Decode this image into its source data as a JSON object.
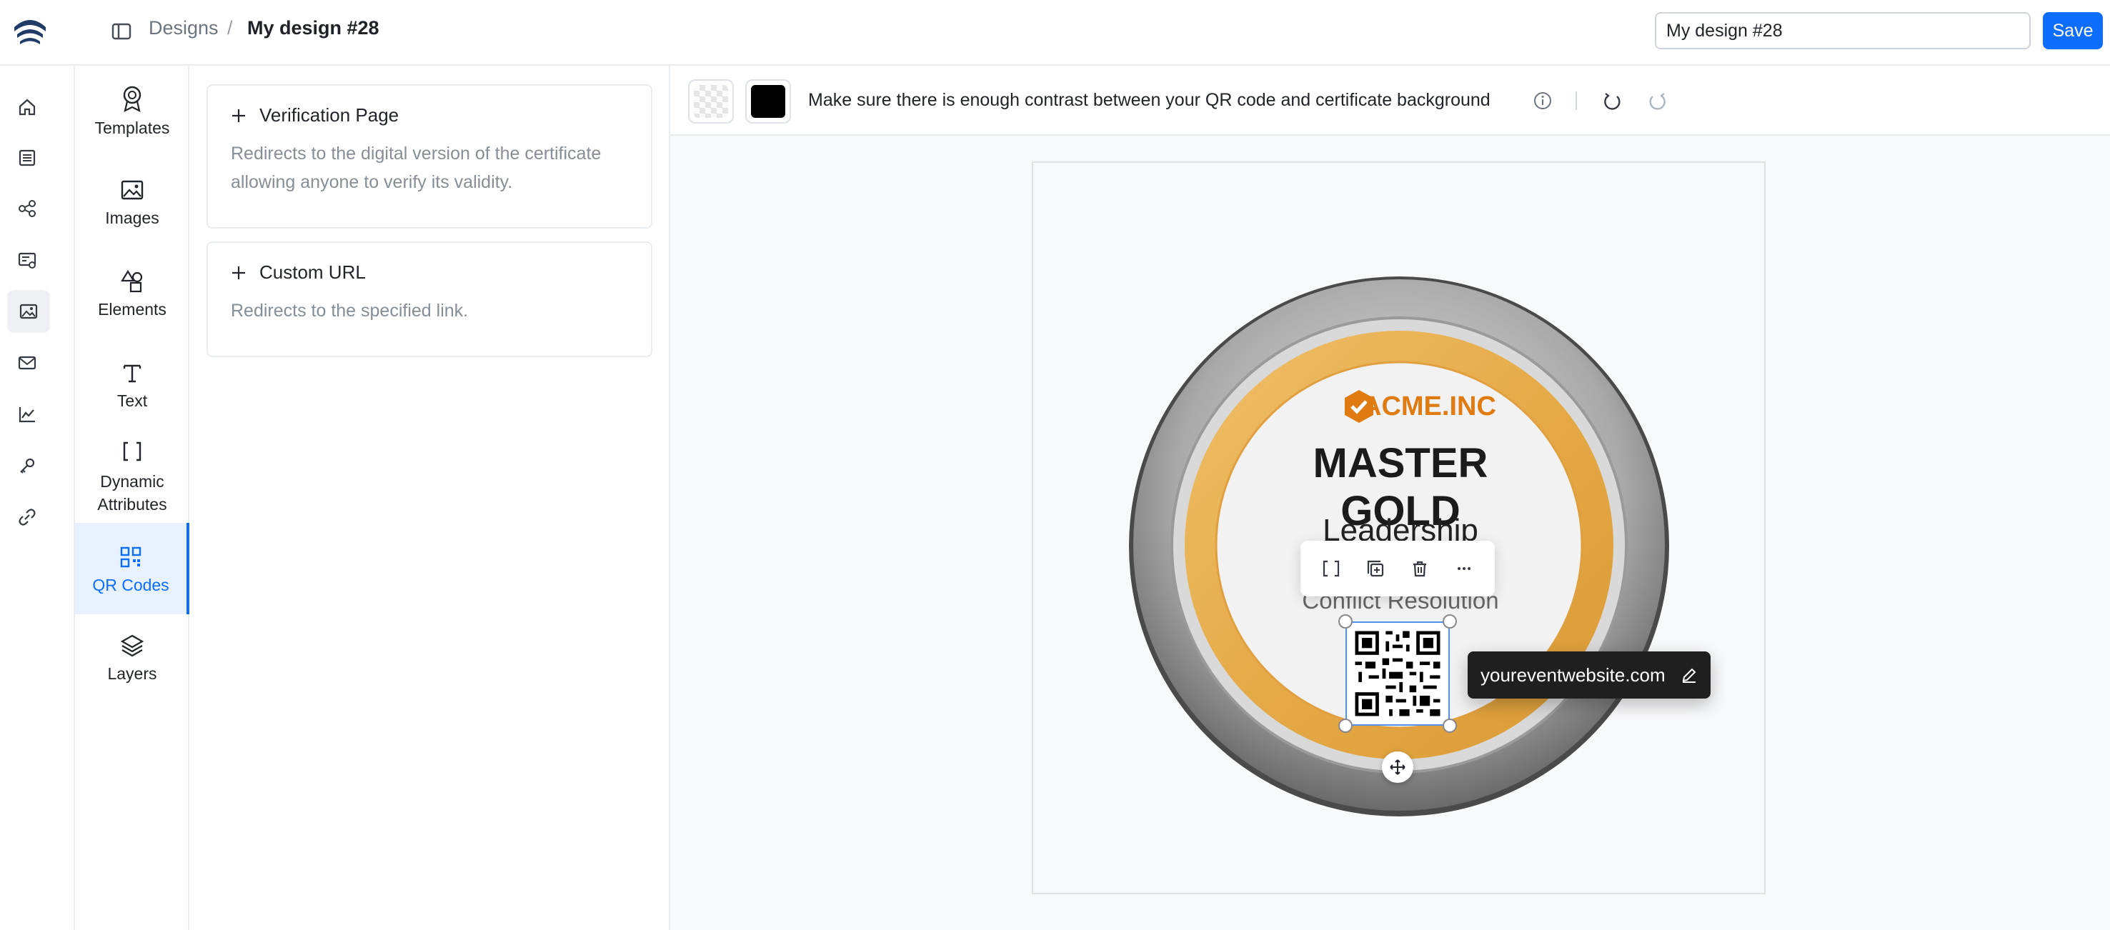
{
  "header": {
    "breadcrumb_root": "Designs",
    "breadcrumb_sep": "/",
    "breadcrumb_current": "My design #28",
    "design_name_value": "My design #28",
    "save_label": "Save"
  },
  "rail": {
    "items": [
      "home-icon",
      "list-icon",
      "share-nodes-icon",
      "badge-id-icon",
      "image-icon",
      "mail-icon",
      "chart-line-icon",
      "key-icon",
      "link-icon"
    ],
    "active": "image-icon"
  },
  "tools": {
    "items": [
      {
        "label": "Templates",
        "icon": "award-icon"
      },
      {
        "label": "Images",
        "icon": "image-icon"
      },
      {
        "label": "Elements",
        "icon": "shapes-icon"
      },
      {
        "label": "Text",
        "icon": "text-icon"
      },
      {
        "label_line1": "Dynamic",
        "label_line2": "Attributes",
        "icon": "brackets-icon"
      },
      {
        "label": "QR Codes",
        "icon": "qr-icon"
      },
      {
        "label": "Layers",
        "icon": "layers-icon"
      }
    ],
    "active": "QR Codes"
  },
  "panel": {
    "verification": {
      "title": "Verification Page",
      "desc": "Redirects to the digital version of the certificate allowing anyone to verify its validity."
    },
    "custom_url": {
      "title": "Custom URL",
      "desc": "Redirects to the specified link."
    }
  },
  "toolbar": {
    "contrast_message": "Make sure there is enough contrast between your QR code and certificate background",
    "fg_color": "#000000"
  },
  "certificate": {
    "brand": "ACME.INC",
    "title": "MASTER GOLD",
    "subtitle": "Leadership",
    "skill": "Conflict Resolution",
    "brand_color": "#e07b12",
    "ring_color": "#e8b04f"
  },
  "qr_tooltip": {
    "url": "youreventwebsite.com"
  }
}
